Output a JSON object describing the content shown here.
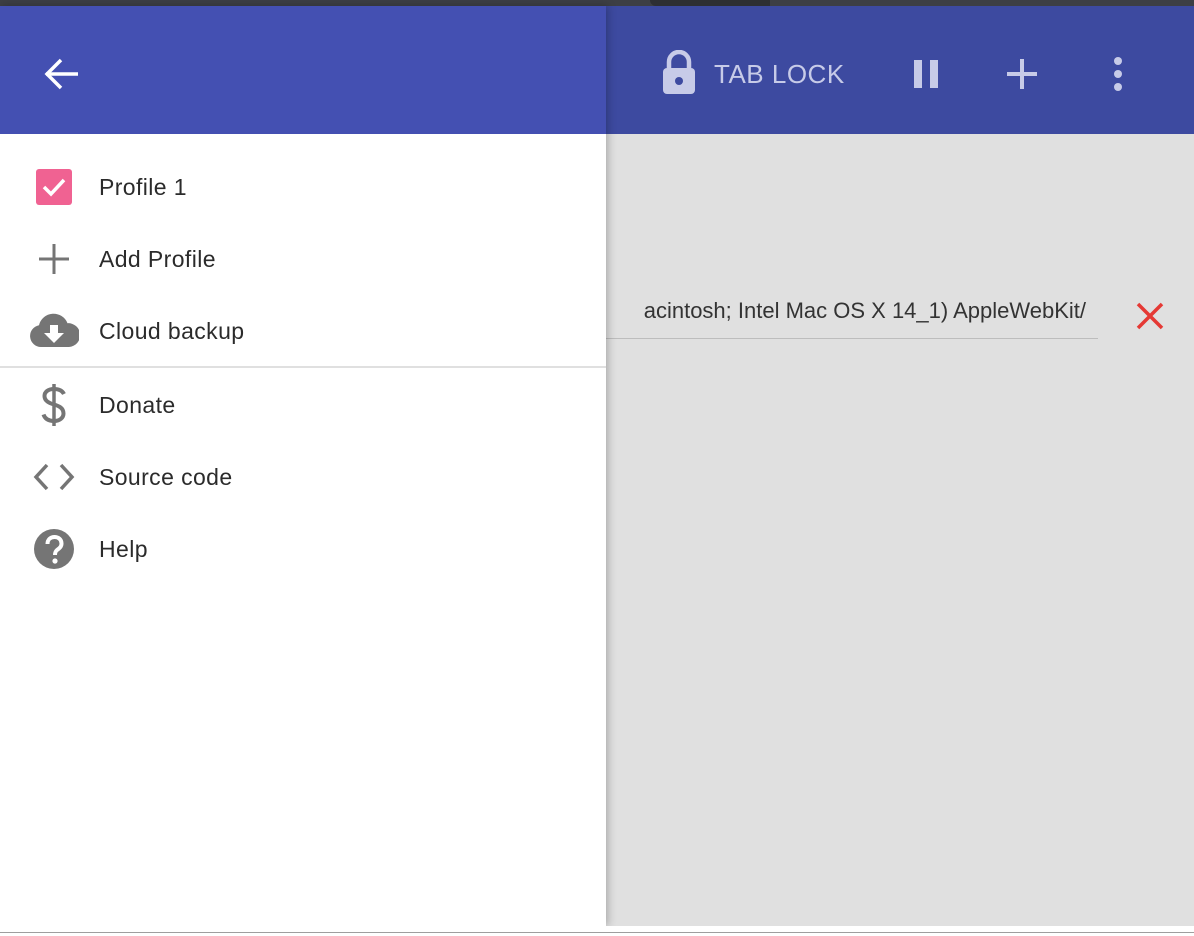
{
  "header": {
    "tab_lock_label": "TAB LOCK"
  },
  "content": {
    "user_agent_value": "acintosh; Intel Mac OS X 14_1) AppleWebKit/"
  },
  "drawer": {
    "items_top": [
      {
        "label": "Profile 1",
        "icon": "checkbox-checked-icon"
      },
      {
        "label": "Add Profile",
        "icon": "plus-icon"
      },
      {
        "label": "Cloud backup",
        "icon": "cloud-download-icon"
      }
    ],
    "items_bottom": [
      {
        "label": "Donate",
        "icon": "dollar-icon"
      },
      {
        "label": "Source code",
        "icon": "code-icon"
      },
      {
        "label": "Help",
        "icon": "help-circle-icon"
      }
    ]
  },
  "colors": {
    "toolbar": "#3d4aa0",
    "drawer_header": "#4450b2",
    "checkbox": "#f06292",
    "clear_icon": "#e53935",
    "icon_gray": "#757575"
  }
}
